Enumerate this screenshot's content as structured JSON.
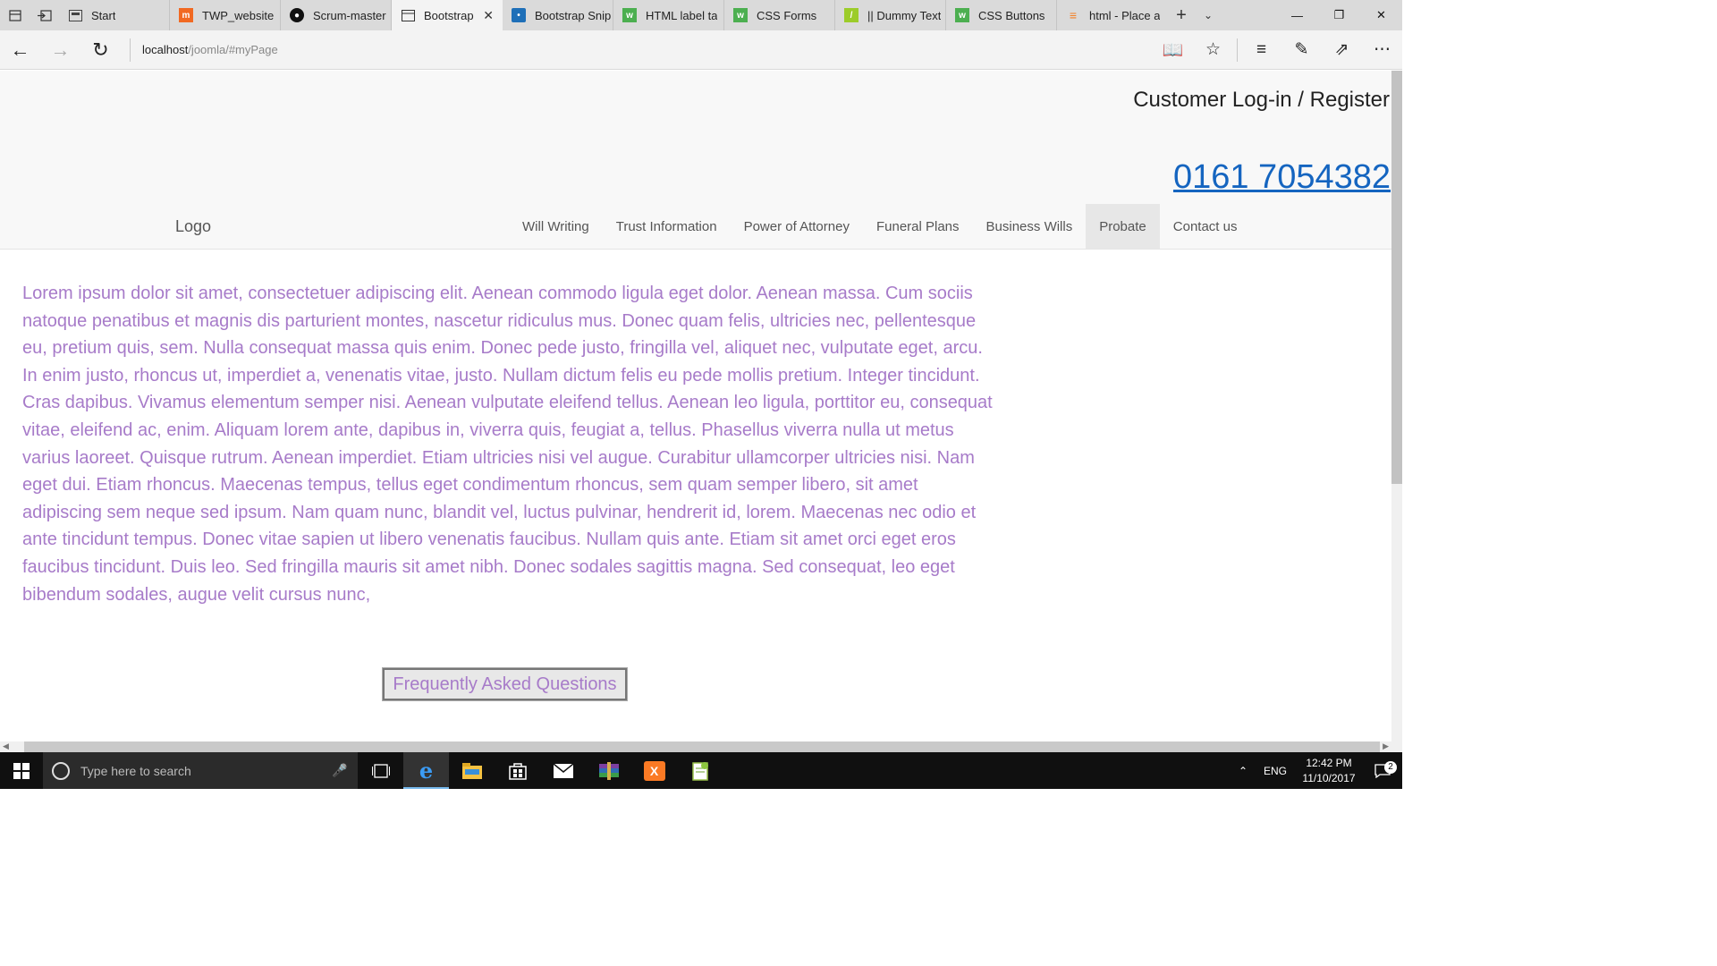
{
  "browser": {
    "tabs": [
      {
        "label": "Start",
        "favicon": "edge-start-icon"
      },
      {
        "label": "TWP_website",
        "favicon": "moodle-icon"
      },
      {
        "label": "Scrum-master",
        "favicon": "github-icon"
      },
      {
        "label": "Bootstrap",
        "favicon": "page-icon",
        "active": true
      },
      {
        "label": "Bootstrap Snip",
        "favicon": "bootsnipp-icon"
      },
      {
        "label": "HTML label ta",
        "favicon": "w3schools-icon"
      },
      {
        "label": "CSS Forms",
        "favicon": "w3schools-icon"
      },
      {
        "label": "|| Dummy Text",
        "favicon": "dummytext-icon"
      },
      {
        "label": "CSS Buttons",
        "favicon": "w3schools-icon"
      },
      {
        "label": "html - Place a",
        "favicon": "stackoverflow-icon"
      }
    ],
    "url_host": "localhost",
    "url_path": "/joomla/#myPage"
  },
  "site": {
    "login_link": "Customer Log-in / Register",
    "phone": "0161 7054382",
    "logo": "Logo",
    "nav": [
      {
        "label": "Will Writing"
      },
      {
        "label": "Trust Information"
      },
      {
        "label": "Power of Attorney"
      },
      {
        "label": "Funeral Plans"
      },
      {
        "label": "Business Wills"
      },
      {
        "label": "Probate",
        "active": true
      },
      {
        "label": "Contact us"
      }
    ],
    "body_text": "Lorem ipsum dolor sit amet, consectetuer adipiscing elit. Aenean commodo ligula eget dolor. Aenean massa. Cum sociis natoque penatibus et magnis dis parturient montes, nascetur ridiculus mus. Donec quam felis, ultricies nec, pellentesque eu, pretium quis, sem. Nulla consequat massa quis enim. Donec pede justo, fringilla vel, aliquet nec, vulputate eget, arcu. In enim justo, rhoncus ut, imperdiet a, venenatis vitae, justo. Nullam dictum felis eu pede mollis pretium. Integer tincidunt. Cras dapibus. Vivamus elementum semper nisi. Aenean vulputate eleifend tellus. Aenean leo ligula, porttitor eu, consequat vitae, eleifend ac, enim. Aliquam lorem ante, dapibus in, viverra quis, feugiat a, tellus. Phasellus viverra nulla ut metus varius laoreet. Quisque rutrum. Aenean imperdiet. Etiam ultricies nisi vel augue. Curabitur ullamcorper ultricies nisi. Nam eget dui. Etiam rhoncus. Maecenas tempus, tellus eget condimentum rhoncus, sem quam semper libero, sit amet adipiscing sem neque sed ipsum. Nam quam nunc, blandit vel, luctus pulvinar, hendrerit id, lorem. Maecenas nec odio et ante tincidunt tempus. Donec vitae sapien ut libero venenatis faucibus. Nullam quis ante. Etiam sit amet orci eget eros faucibus tincidunt. Duis leo. Sed fringilla mauris sit amet nibh. Donec sodales sagittis magna. Sed consequat, leo eget bibendum sodales, augue velit cursus nunc,",
    "faq_button": "Frequently Asked Questions"
  },
  "taskbar": {
    "search_placeholder": "Type here to search",
    "apps": [
      "task-view-icon",
      "edge-icon",
      "file-explorer-icon",
      "store-icon",
      "mail-icon",
      "winrar-icon",
      "xampp-icon",
      "notepadpp-icon"
    ],
    "language": "ENG",
    "time": "12:42 PM",
    "date": "11/10/2017",
    "notification_count": "2"
  },
  "colors": {
    "text_purple": "#a77bc9",
    "phone_blue": "#1565c0",
    "edge_blue": "#0078d7"
  }
}
